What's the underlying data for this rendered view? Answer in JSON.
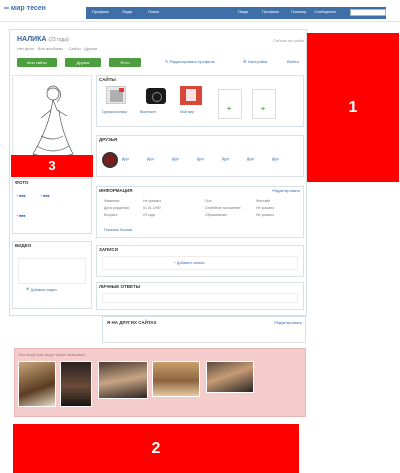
{
  "topbar": {
    "logo": "∞ мир тесен",
    "nav": [
      "Профиль",
      "Люди",
      "Поиск"
    ],
    "right": [
      "Люди",
      "Профиль",
      "Помощь",
      "Сообщения"
    ]
  },
  "profile": {
    "name": "НАЛИКА",
    "age": "(23 года)",
    "status": "Нет фото · Все альбомы",
    "status2": "Сайты · Друзья",
    "right_info": "Сейчас на сайте"
  },
  "buttons": [
    "Мои сайты",
    "Друзья",
    "Фото"
  ],
  "links": [
    "Редактировать профиль",
    "Настройки",
    "Выйти"
  ],
  "sites": {
    "title": "САЙТЫ",
    "items": [
      "Одноклассники",
      "Вконтакте",
      "Мой мир"
    ]
  },
  "friends": {
    "title": "ДРУЗЬЯ",
    "items": [
      "Друг",
      "Друг",
      "Друг",
      "Друг",
      "Друг",
      "Друг",
      "Друг"
    ]
  },
  "info": {
    "title": "ИНФОРМАЦИЯ",
    "link": "Редактировать",
    "rows_left": [
      "Фамилия:",
      "Дата рождения:",
      "Возраст:"
    ],
    "vals_left": [
      "Не указано",
      "01.01.1990",
      "23 года"
    ],
    "rows_right": [
      "Пол:",
      "Семейное положение:",
      "Образование:"
    ],
    "vals_right": [
      "Женский",
      "Не указано",
      "Не указано"
    ],
    "more": "Показать больше"
  },
  "blocks": [
    {
      "title": "ФОТО"
    },
    {
      "title": "ВИДЕО",
      "action": "Добавить видео"
    },
    {
      "title": "ЗАПИСИ",
      "action": "Добавить запись"
    },
    {
      "title": "ЛИЧНЫЕ ОТВЕТЫ"
    }
  ],
  "mini": {
    "title": "Я НА ДРУГИХ САЙТАХ",
    "link": "Редактировать"
  },
  "people": {
    "title": "Эти люди уже ищут своих знакомых"
  },
  "callouts": [
    "1",
    "2",
    "3"
  ],
  "colors": {
    "accent": "#3e6fa8",
    "green": "#4c9e3e",
    "callout": "#ff0000",
    "pink": "#f4cccc"
  }
}
